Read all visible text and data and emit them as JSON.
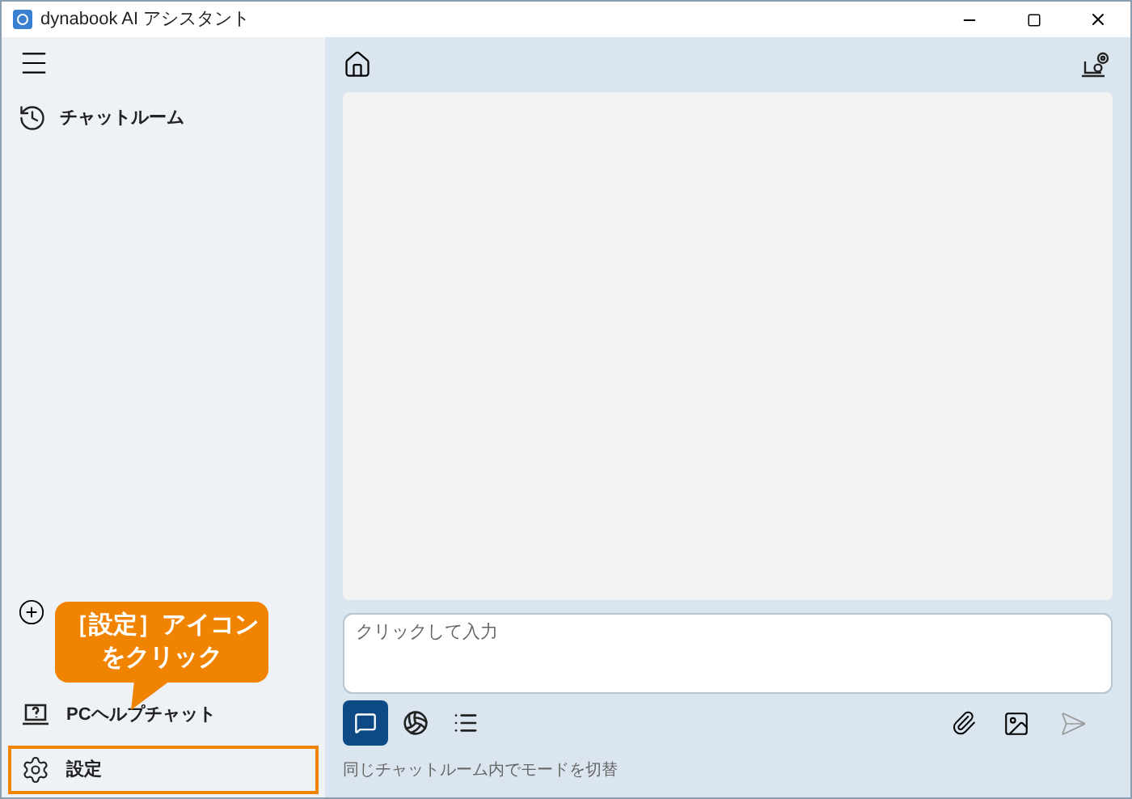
{
  "window": {
    "title": "dynabook AI アシスタント"
  },
  "sidebar": {
    "items": [
      {
        "kind": "history",
        "label": "チャットルーム"
      }
    ],
    "new_chat": {
      "kind": "plus"
    },
    "bottom_items": [
      {
        "kind": "help",
        "label": "PCヘルプチャット",
        "highlighted": false
      },
      {
        "kind": "settings",
        "label": "設定",
        "highlighted": true
      }
    ]
  },
  "callout": {
    "lines": [
      "［設定］アイコン",
      "をクリック"
    ]
  },
  "input": {
    "placeholder": "クリックして入力"
  },
  "modes": [
    {
      "kind": "chat",
      "selected": true
    },
    {
      "kind": "web",
      "selected": false
    },
    {
      "kind": "list",
      "selected": false
    }
  ],
  "hint": "同じチャットルーム内でモードを切替"
}
